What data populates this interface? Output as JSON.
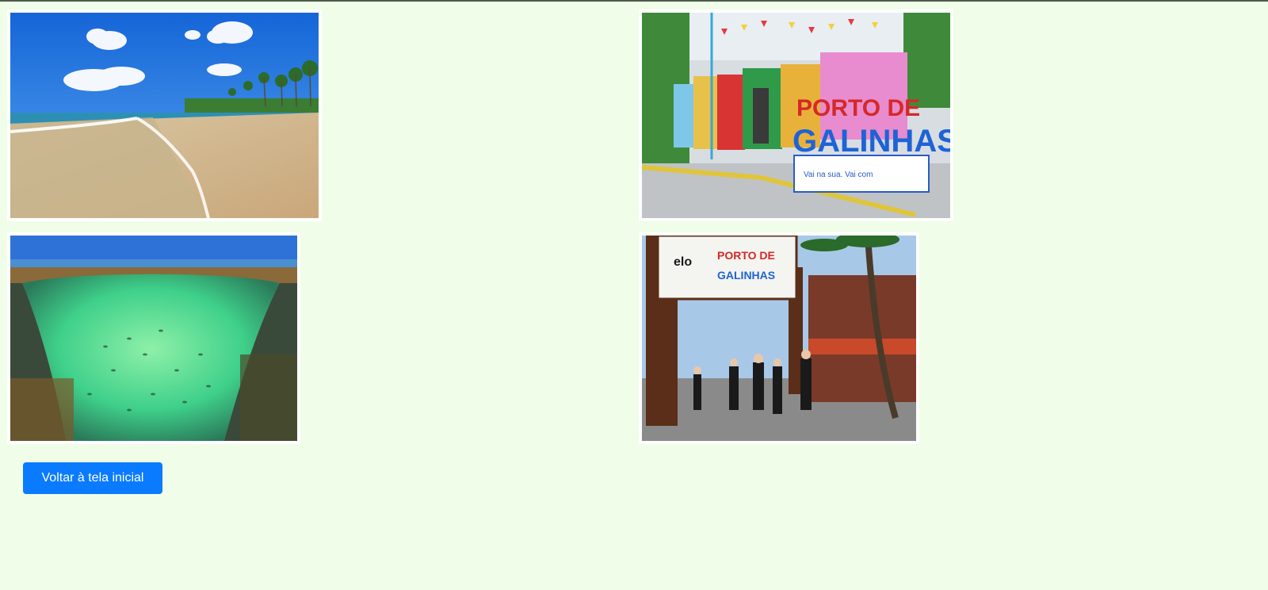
{
  "page": {
    "background": "#f0fde8"
  },
  "gallery": {
    "photos": [
      {
        "name": "beach-photo",
        "subject": "palm-lined sandy beach"
      },
      {
        "name": "town-sign-photo",
        "subject": "colorful Porto de Galinhas letter sign",
        "sign_text": [
          "PORTO DE",
          "GALINHAS"
        ],
        "tagline": "Vai na sua. Vai com"
      },
      {
        "name": "natural-pool-photo",
        "subject": "turquoise natural pool with fish"
      },
      {
        "name": "entrance-arch-photo",
        "subject": "wooden arch with Porto de Galinhas sign",
        "sign_text": [
          "PORTO DE",
          "GALINHAS"
        ],
        "brand": "elo"
      }
    ]
  },
  "actions": {
    "back_label": "Voltar à tela inicial",
    "accent": "#0a7bff"
  }
}
